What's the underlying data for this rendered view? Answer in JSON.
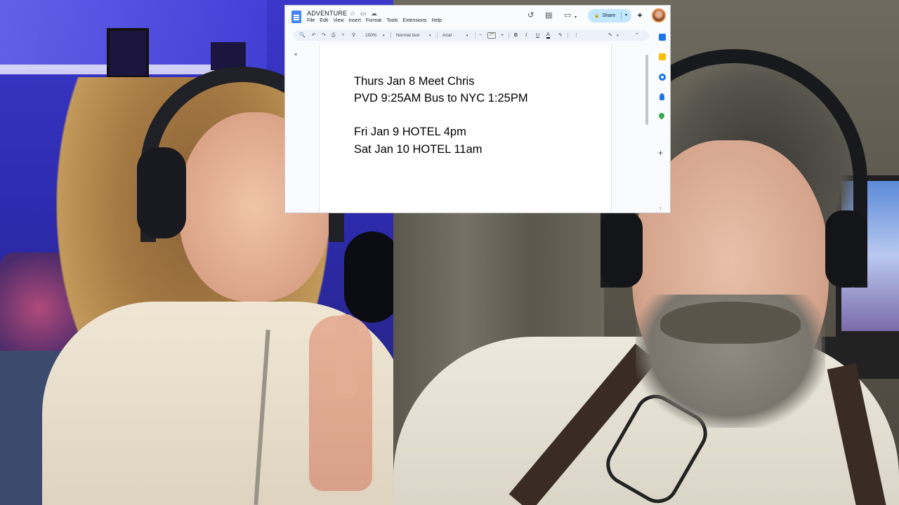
{
  "document": {
    "title": "ADVENTURE",
    "menu": [
      "File",
      "Edit",
      "View",
      "Insert",
      "Format",
      "Tools",
      "Extensions",
      "Help"
    ],
    "share_label": "Share",
    "toolbar": {
      "zoom": "100%",
      "style": "Normal text",
      "font": "Arial",
      "font_size": "27"
    },
    "body_lines": [
      "Thurs Jan 8 Meet Chris",
      "PVD 9:25AM Bus to NYC 1:25PM",
      "Fri Jan 9 HOTEL 4pm",
      "Sat Jan 10 HOTEL 11am"
    ]
  },
  "icons": {
    "star": "☆",
    "folder": "▭",
    "cloud": "☁",
    "history": "↺",
    "comment": "▤",
    "meet": "▭",
    "gemini": "✦",
    "search": "🔍",
    "undo": "↶",
    "redo": "↷",
    "print": "⎙",
    "spell": "ᵃ",
    "paint": "⚲",
    "minus": "−",
    "plus": "+",
    "bold": "B",
    "italic": "I",
    "underline": "U",
    "text_color": "A",
    "highlight": "✎",
    "more": "⋮",
    "pencil": "✎",
    "collapse": "⌃",
    "outline": "≡",
    "add": "+",
    "chevron": "›",
    "caret": "▾"
  },
  "colors": {
    "share_bg": "#c2e7ff",
    "docs_blue": "#4285f4",
    "keep_yellow": "#fbbc04",
    "tasks_blue": "#1a73e8",
    "contacts_blue": "#1a73e8",
    "maps_green": "#34a853"
  }
}
